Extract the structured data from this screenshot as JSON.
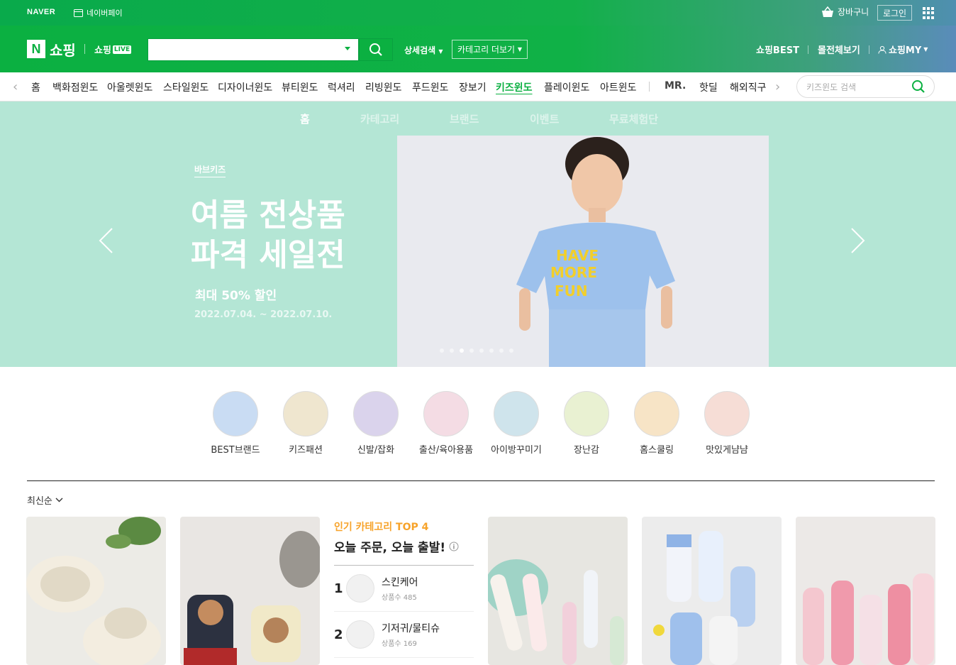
{
  "topbar": {
    "naver": "NAVER",
    "npay": "네이버페이",
    "cart": "장바구니",
    "login": "로그인"
  },
  "header": {
    "logo_letter": "N",
    "shop": "쇼핑",
    "live_prefix": "쇼핑",
    "live_badge": "LIVE",
    "search_value": "",
    "detail_search": "상세검색",
    "category_more": "카테고리 더보기",
    "best": "쇼핑BEST",
    "mall_all": "몰전체보기",
    "my": "쇼핑MY"
  },
  "nav": {
    "items": [
      "홈",
      "백화점윈도",
      "아울렛윈도",
      "스타일윈도",
      "디자이너윈도",
      "뷰티윈도",
      "럭셔리",
      "리빙윈도",
      "푸드윈도",
      "장보기",
      "키즈윈도",
      "플레이윈도",
      "아트윈도",
      "MR.",
      "핫딜",
      "해외직구"
    ],
    "active": "키즈윈도",
    "search_placeholder": "키즈윈도 검색"
  },
  "hero": {
    "tabs": [
      "홈",
      "카테고리",
      "브랜드",
      "이벤트",
      "무료체험단"
    ],
    "brand": "바브키즈",
    "title": "여름 전상품\n파격 세일전",
    "subtitle": "최대 50% 할인",
    "date": "2022.07.04. ~ 2022.07.10.",
    "shirt_text": "HAVE MORE FUN",
    "dots_total": 8,
    "dots_active": 3
  },
  "categories": [
    "BEST브랜드",
    "키즈패션",
    "신발/잡화",
    "출산/육아용품",
    "아이방꾸미기",
    "장난감",
    "홈스쿨링",
    "맛있게냠냠"
  ],
  "sort": {
    "label": "최신순"
  },
  "top4": {
    "heading": "인기 카테고리 TOP 4",
    "title": "오늘 주문, 오늘 출발!",
    "items": [
      {
        "rank": "1",
        "name": "스킨케어",
        "count": "상품수 485"
      },
      {
        "rank": "2",
        "name": "기저귀/물티슈",
        "count": "상품수 169"
      }
    ]
  },
  "colors": {
    "brand_green": "#0bb041",
    "hero_bg": "#b4e6d5",
    "accent_orange": "#f7a32a"
  }
}
